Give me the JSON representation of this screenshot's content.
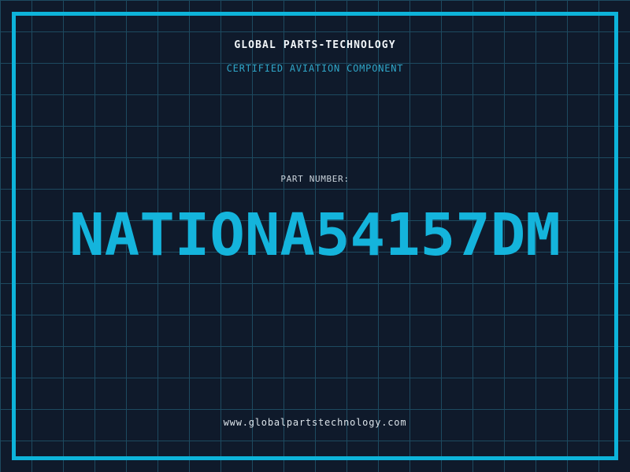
{
  "header": {
    "company": "GLOBAL PARTS-TECHNOLOGY",
    "tagline": "CERTIFIED AVIATION COMPONENT"
  },
  "part": {
    "label": "PART NUMBER:",
    "number": "NATIONA54157DM"
  },
  "footer": {
    "website": "www.globalpartstechnology.com"
  },
  "colors": {
    "background": "#0f1a2b",
    "grid_line": "#1d4a60",
    "frame_accent": "#0db4da",
    "part_number_accent": "#14b4dc",
    "tagline_cyan": "#2fa6c8",
    "title_white": "#f2f6f9",
    "label_gray": "#c9d2da"
  }
}
